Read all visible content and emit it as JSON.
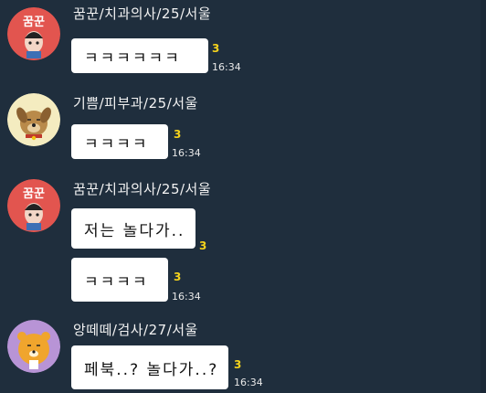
{
  "colors": {
    "background": "#1f2e3d",
    "bubble": "#ffffff",
    "unread": "#f5d21c",
    "text_light": "#f2f2f2"
  },
  "messages": [
    {
      "sender": "꿈꾼/치과의사/25/서울",
      "avatar": "kkumkkun-avatar",
      "avatar_text": "꿈꾼",
      "bubbles": [
        {
          "text": "ㅋㅋㅋㅋㅋㅋ",
          "unread": "3",
          "time": "16:34"
        }
      ]
    },
    {
      "sender": "기쁨/피부과/25/서울",
      "avatar": "dog-avatar",
      "bubbles": [
        {
          "text": "ㅋㅋㅋㅋ",
          "unread": "3",
          "time": "16:34"
        }
      ]
    },
    {
      "sender": "꿈꾼/치과의사/25/서울",
      "avatar": "kkumkkun-avatar",
      "avatar_text": "꿈꾼",
      "bubbles": [
        {
          "text": "저는 놀다가..",
          "unread": "3",
          "time": ""
        },
        {
          "text": "ㅋㅋㅋㅋ",
          "unread": "3",
          "time": "16:34"
        }
      ]
    },
    {
      "sender": "앙떼떼/검사/27/서울",
      "avatar": "lion-avatar",
      "bubbles": [
        {
          "text": "페북..? 놀다가..?",
          "unread": "3",
          "time": "16:34"
        }
      ]
    }
  ]
}
